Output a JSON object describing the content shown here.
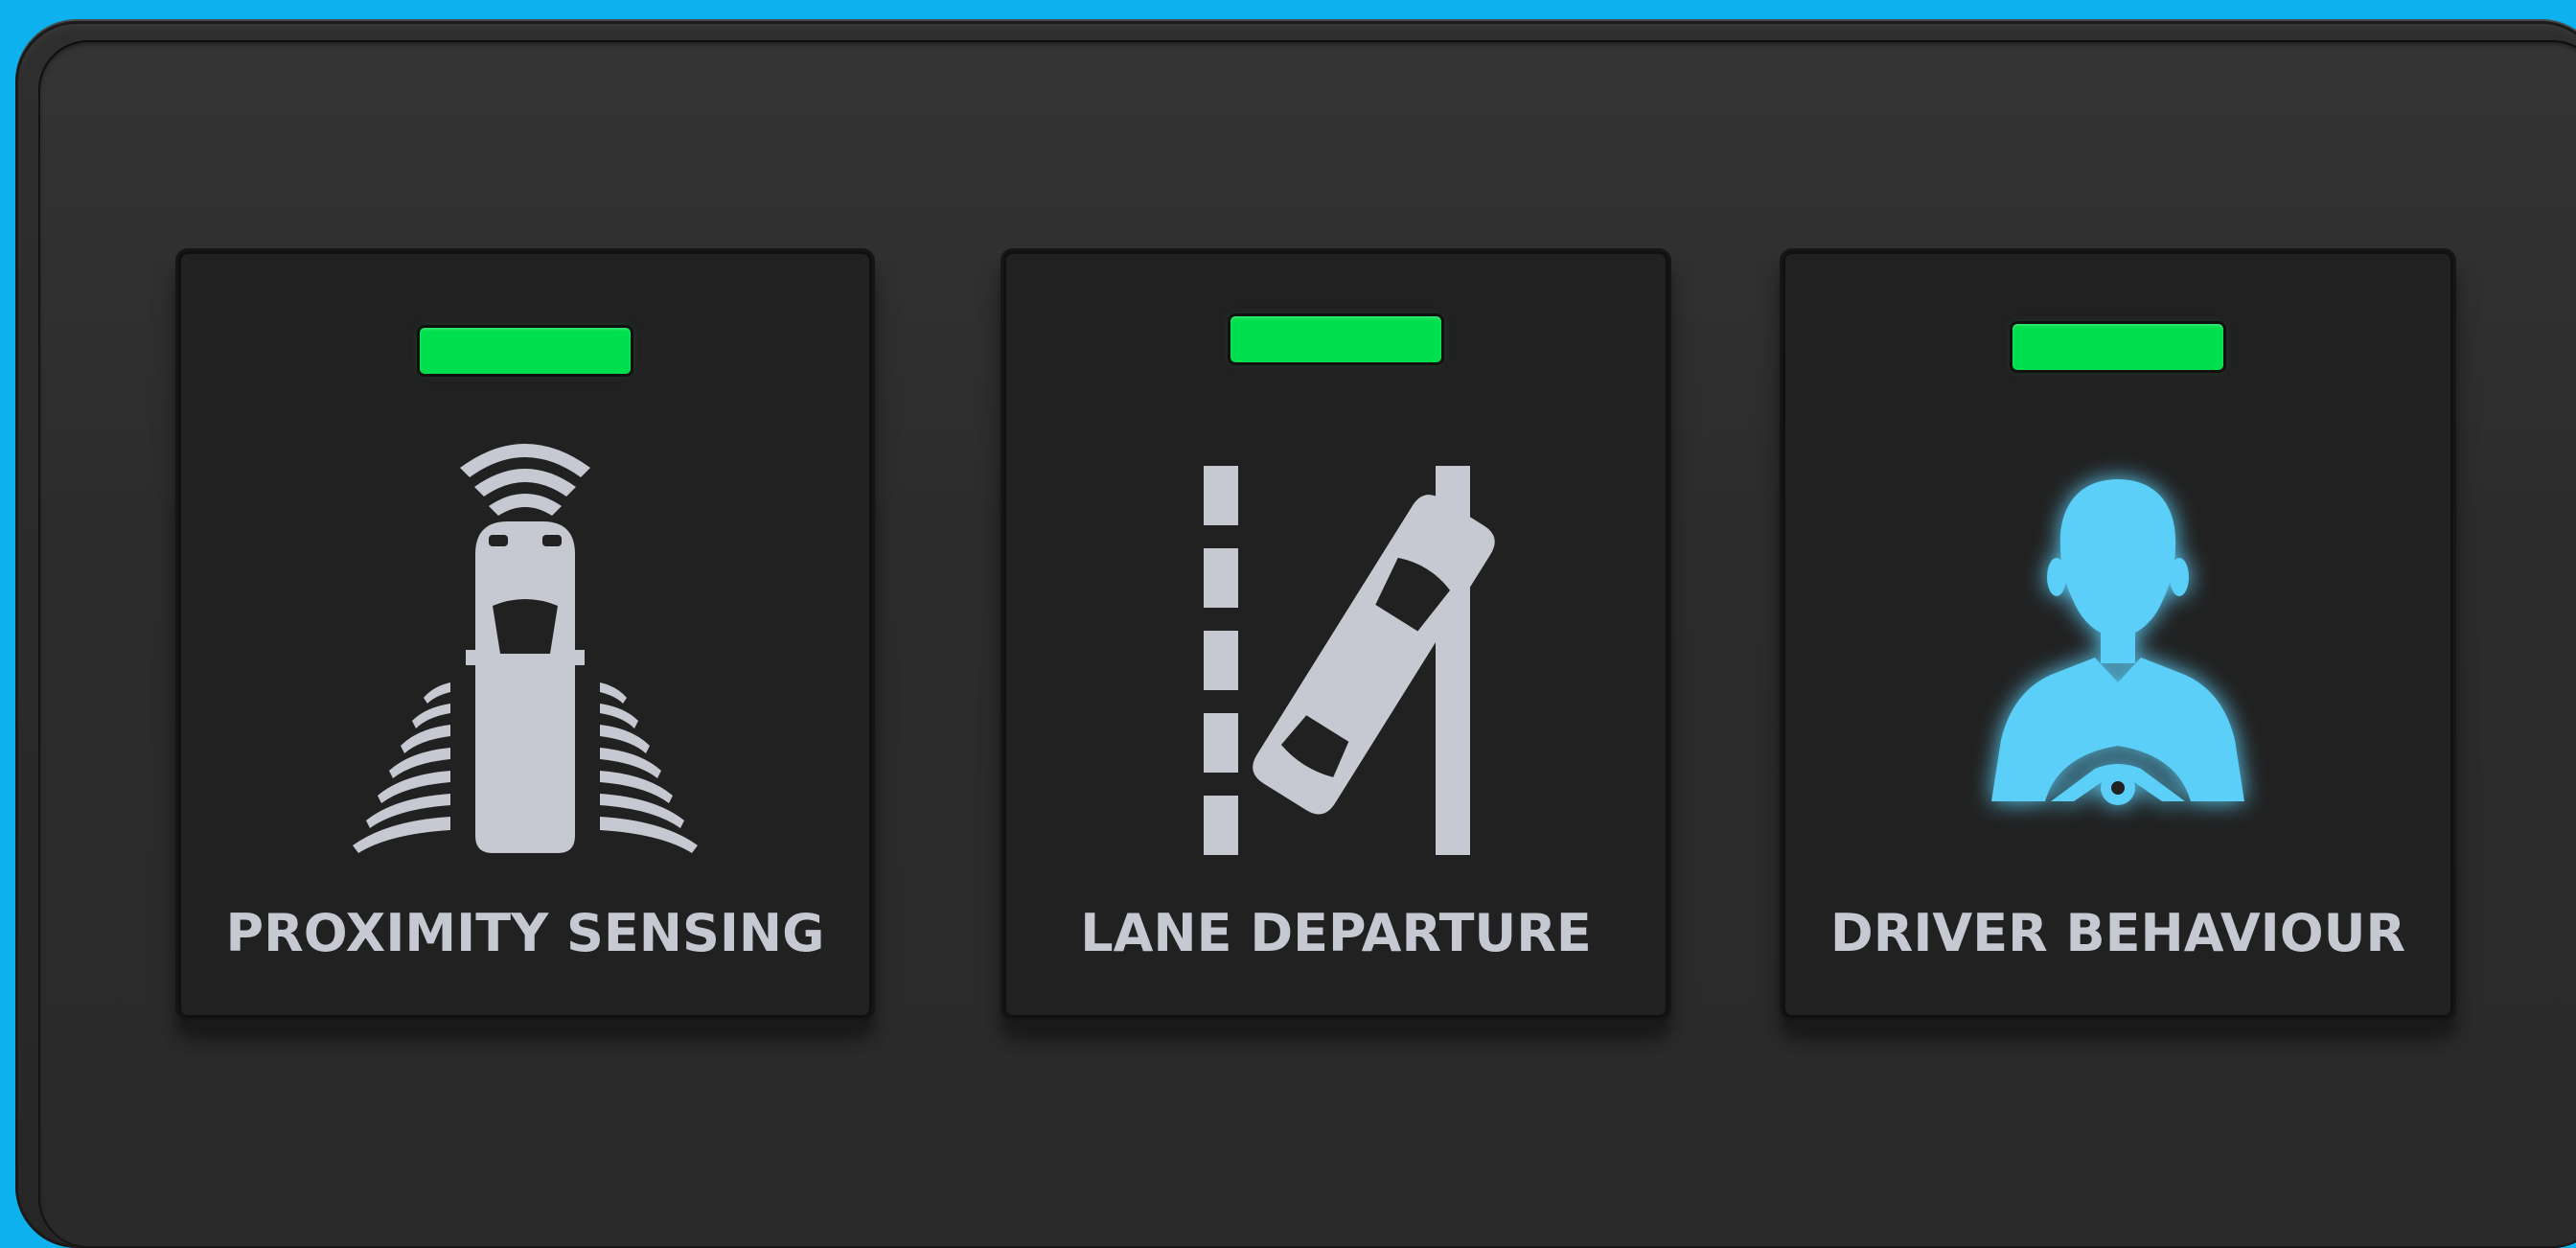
{
  "colors": {
    "background": "#0cb1ee",
    "panel": "#2c2c2c",
    "tile": "#212121",
    "status_led_ok": "#00e04e",
    "icon_default": "#c6c8d2",
    "icon_active": "#5bcff8"
  },
  "tiles": [
    {
      "label": "PROXIMITY SENSING",
      "icon": "proximity-sensing-icon",
      "status": "ok",
      "active": false
    },
    {
      "label": "LANE DEPARTURE",
      "icon": "lane-departure-icon",
      "status": "ok",
      "active": false
    },
    {
      "label": "DRIVER BEHAVIOUR",
      "icon": "driver-behaviour-icon",
      "status": "ok",
      "active": true
    }
  ]
}
